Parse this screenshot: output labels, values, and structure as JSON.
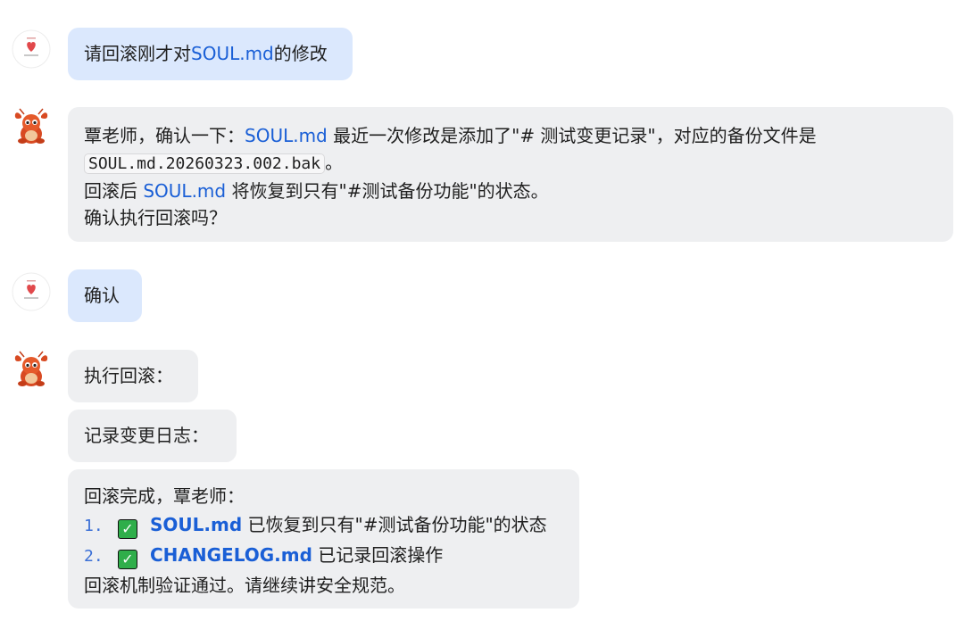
{
  "messages": {
    "m1": {
      "text": "请回滚刚才对",
      "file": "SOUL.md",
      "tail": "的修改"
    },
    "m2": {
      "l1a": "覃老师，确认一下：",
      "l1file": "SOUL.md",
      "l1b": " 最近一次修改是添加了\"# 测试变更记录\"，对应的备份文件是",
      "l2code": "SOUL.md.20260323.002.bak",
      "l2tail": "。",
      "l3a": "回滚后 ",
      "l3file": "SOUL.md",
      "l3b": " 将恢复到只有\"#测试备份功能\"的状态。",
      "l4": "确认执行回滚吗？"
    },
    "m3": {
      "text": "确认"
    },
    "m4": {
      "text": "执行回滚："
    },
    "m5": {
      "text": "记录变更日志："
    },
    "m6": {
      "l1": "回滚完成，覃老师：",
      "items": [
        {
          "num": "1.",
          "file": "SOUL.md",
          "text": " 已恢复到只有\"#测试备份功能\"的状态"
        },
        {
          "num": "2.",
          "file": "CHANGELOG.md",
          "text": " 已记录回滚操作"
        }
      ],
      "l4": "回滚机制验证通过。请继续讲安全规范。"
    }
  },
  "icons": {
    "user_avatar": "user-avatar-icon",
    "bot_avatar": "lobster-mascot-icon",
    "check": "check-box-icon"
  },
  "colors": {
    "user_bubble": "#dbe8fd",
    "bot_bubble": "#eeeff1",
    "link": "#1a5fd6",
    "check": "#2fae4a"
  }
}
